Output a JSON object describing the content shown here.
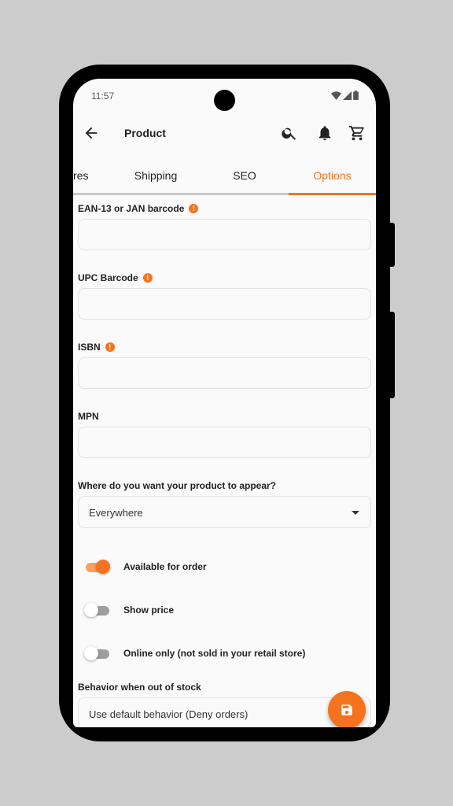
{
  "status_bar": {
    "time": "11:57"
  },
  "app_bar": {
    "title": "Product",
    "icons": [
      "back-arrow-icon",
      "search-icon",
      "bell-icon",
      "cart-icon"
    ]
  },
  "tabs": [
    {
      "label": "res",
      "active": false
    },
    {
      "label": "Shipping",
      "active": false
    },
    {
      "label": "SEO",
      "active": false
    },
    {
      "label": "Options",
      "active": true
    }
  ],
  "form": {
    "ean": {
      "label": "EAN-13 or JAN barcode",
      "value": ""
    },
    "upc": {
      "label": "UPC Barcode",
      "value": ""
    },
    "isbn": {
      "label": "ISBN",
      "value": ""
    },
    "mpn": {
      "label": "MPN",
      "value": ""
    },
    "visibility": {
      "label": "Where do you want your product to appear?",
      "value": "Everywhere"
    },
    "toggles": [
      {
        "label": "Available for order",
        "on": true
      },
      {
        "label": "Show price",
        "on": false
      },
      {
        "label": "Online only (not sold in your retail store)",
        "on": false
      }
    ],
    "out_of_stock": {
      "label": "Behavior when out of stock",
      "value": "Use default behavior (Deny orders)"
    }
  },
  "fab": {
    "icon": "save-icon"
  },
  "colors": {
    "accent": "#f5731f",
    "background": "#fafafa"
  }
}
